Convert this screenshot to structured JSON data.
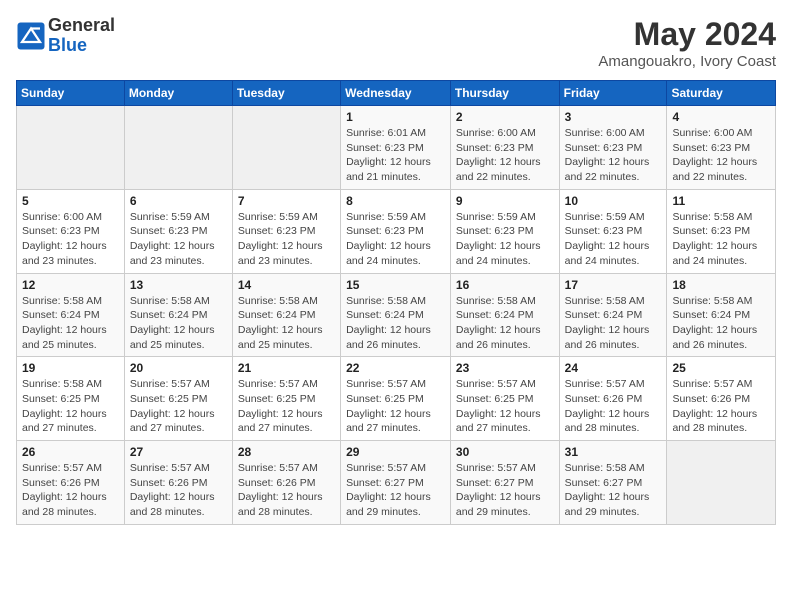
{
  "header": {
    "logo_line1": "General",
    "logo_line2": "Blue",
    "title": "May 2024",
    "subtitle": "Amangouakro, Ivory Coast"
  },
  "calendar": {
    "days_of_week": [
      "Sunday",
      "Monday",
      "Tuesday",
      "Wednesday",
      "Thursday",
      "Friday",
      "Saturday"
    ],
    "weeks": [
      [
        {
          "day": "",
          "info": ""
        },
        {
          "day": "",
          "info": ""
        },
        {
          "day": "",
          "info": ""
        },
        {
          "day": "1",
          "info": "Sunrise: 6:01 AM\nSunset: 6:23 PM\nDaylight: 12 hours\nand 21 minutes."
        },
        {
          "day": "2",
          "info": "Sunrise: 6:00 AM\nSunset: 6:23 PM\nDaylight: 12 hours\nand 22 minutes."
        },
        {
          "day": "3",
          "info": "Sunrise: 6:00 AM\nSunset: 6:23 PM\nDaylight: 12 hours\nand 22 minutes."
        },
        {
          "day": "4",
          "info": "Sunrise: 6:00 AM\nSunset: 6:23 PM\nDaylight: 12 hours\nand 22 minutes."
        }
      ],
      [
        {
          "day": "5",
          "info": "Sunrise: 6:00 AM\nSunset: 6:23 PM\nDaylight: 12 hours\nand 23 minutes."
        },
        {
          "day": "6",
          "info": "Sunrise: 5:59 AM\nSunset: 6:23 PM\nDaylight: 12 hours\nand 23 minutes."
        },
        {
          "day": "7",
          "info": "Sunrise: 5:59 AM\nSunset: 6:23 PM\nDaylight: 12 hours\nand 23 minutes."
        },
        {
          "day": "8",
          "info": "Sunrise: 5:59 AM\nSunset: 6:23 PM\nDaylight: 12 hours\nand 24 minutes."
        },
        {
          "day": "9",
          "info": "Sunrise: 5:59 AM\nSunset: 6:23 PM\nDaylight: 12 hours\nand 24 minutes."
        },
        {
          "day": "10",
          "info": "Sunrise: 5:59 AM\nSunset: 6:23 PM\nDaylight: 12 hours\nand 24 minutes."
        },
        {
          "day": "11",
          "info": "Sunrise: 5:58 AM\nSunset: 6:23 PM\nDaylight: 12 hours\nand 24 minutes."
        }
      ],
      [
        {
          "day": "12",
          "info": "Sunrise: 5:58 AM\nSunset: 6:24 PM\nDaylight: 12 hours\nand 25 minutes."
        },
        {
          "day": "13",
          "info": "Sunrise: 5:58 AM\nSunset: 6:24 PM\nDaylight: 12 hours\nand 25 minutes."
        },
        {
          "day": "14",
          "info": "Sunrise: 5:58 AM\nSunset: 6:24 PM\nDaylight: 12 hours\nand 25 minutes."
        },
        {
          "day": "15",
          "info": "Sunrise: 5:58 AM\nSunset: 6:24 PM\nDaylight: 12 hours\nand 26 minutes."
        },
        {
          "day": "16",
          "info": "Sunrise: 5:58 AM\nSunset: 6:24 PM\nDaylight: 12 hours\nand 26 minutes."
        },
        {
          "day": "17",
          "info": "Sunrise: 5:58 AM\nSunset: 6:24 PM\nDaylight: 12 hours\nand 26 minutes."
        },
        {
          "day": "18",
          "info": "Sunrise: 5:58 AM\nSunset: 6:24 PM\nDaylight: 12 hours\nand 26 minutes."
        }
      ],
      [
        {
          "day": "19",
          "info": "Sunrise: 5:58 AM\nSunset: 6:25 PM\nDaylight: 12 hours\nand 27 minutes."
        },
        {
          "day": "20",
          "info": "Sunrise: 5:57 AM\nSunset: 6:25 PM\nDaylight: 12 hours\nand 27 minutes."
        },
        {
          "day": "21",
          "info": "Sunrise: 5:57 AM\nSunset: 6:25 PM\nDaylight: 12 hours\nand 27 minutes."
        },
        {
          "day": "22",
          "info": "Sunrise: 5:57 AM\nSunset: 6:25 PM\nDaylight: 12 hours\nand 27 minutes."
        },
        {
          "day": "23",
          "info": "Sunrise: 5:57 AM\nSunset: 6:25 PM\nDaylight: 12 hours\nand 27 minutes."
        },
        {
          "day": "24",
          "info": "Sunrise: 5:57 AM\nSunset: 6:26 PM\nDaylight: 12 hours\nand 28 minutes."
        },
        {
          "day": "25",
          "info": "Sunrise: 5:57 AM\nSunset: 6:26 PM\nDaylight: 12 hours\nand 28 minutes."
        }
      ],
      [
        {
          "day": "26",
          "info": "Sunrise: 5:57 AM\nSunset: 6:26 PM\nDaylight: 12 hours\nand 28 minutes."
        },
        {
          "day": "27",
          "info": "Sunrise: 5:57 AM\nSunset: 6:26 PM\nDaylight: 12 hours\nand 28 minutes."
        },
        {
          "day": "28",
          "info": "Sunrise: 5:57 AM\nSunset: 6:26 PM\nDaylight: 12 hours\nand 28 minutes."
        },
        {
          "day": "29",
          "info": "Sunrise: 5:57 AM\nSunset: 6:27 PM\nDaylight: 12 hours\nand 29 minutes."
        },
        {
          "day": "30",
          "info": "Sunrise: 5:57 AM\nSunset: 6:27 PM\nDaylight: 12 hours\nand 29 minutes."
        },
        {
          "day": "31",
          "info": "Sunrise: 5:58 AM\nSunset: 6:27 PM\nDaylight: 12 hours\nand 29 minutes."
        },
        {
          "day": "",
          "info": ""
        }
      ]
    ]
  }
}
